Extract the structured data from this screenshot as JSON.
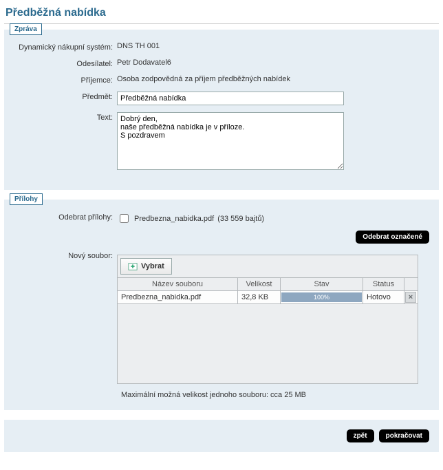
{
  "page": {
    "title": "Předběžná nabídka"
  },
  "message": {
    "legend": "Zpráva",
    "labels": {
      "dns": "Dynamický nákupní systém:",
      "sender": "Odesílatel:",
      "recipient": "Příjemce:",
      "subject": "Předmět:",
      "text": "Text:"
    },
    "dns": "DNS TH 001",
    "sender": "Petr Dodavatel6",
    "recipient": "Osoba zodpovědná za příjem předběžných nabídek",
    "subject": "Předběžná nabídka",
    "text": "Dobrý den,\nnaše předběžná nabídka je v příloze.\nS pozdravem"
  },
  "attachments": {
    "legend": "Přílohy",
    "labels": {
      "remove": "Odebrat přílohy:",
      "newfile": "Nový soubor:"
    },
    "existing": {
      "name": "Predbezna_nabidka.pdf",
      "size_text": "(33 559 bajtů)"
    },
    "remove_btn": "Odebrat označené",
    "select_btn": "Vybrat",
    "table": {
      "headers": {
        "name": "Název souboru",
        "size": "Velikost",
        "state": "Stav",
        "status": "Status"
      },
      "row": {
        "name": "Predbezna_nabidka.pdf",
        "size": "32,8 KB",
        "progress": "100%",
        "status": "Hotovo"
      }
    },
    "max_note": "Maximální možná velikost jednoho souboru: cca 25 MB"
  },
  "footer": {
    "back": "zpět",
    "continue": "pokračovat"
  }
}
